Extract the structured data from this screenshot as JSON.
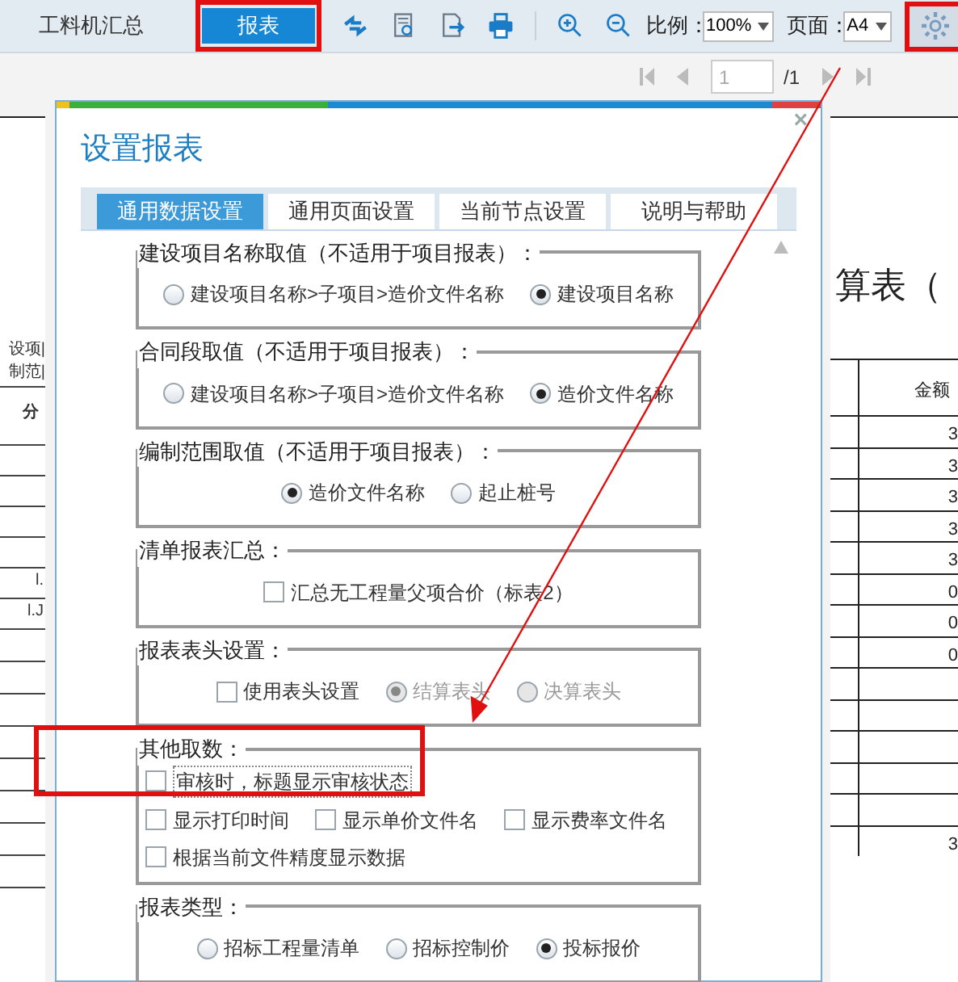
{
  "toolbar": {
    "tabs": [
      {
        "label": "工料机汇总",
        "selected": false
      },
      {
        "label": "报表",
        "selected": true
      }
    ],
    "scale_label": "比例：",
    "scale_value": "100%",
    "page_label": "页面：",
    "page_value": "A4"
  },
  "pager": {
    "page": "1",
    "total": "/1"
  },
  "left_page": {
    "lines": [
      "设项|",
      "制范|"
    ],
    "header": "分",
    "cells": [
      "l.",
      "l.J"
    ]
  },
  "right_page": {
    "title": "算表（",
    "header": "金额",
    "cells": [
      "3",
      "3",
      "3",
      "3",
      "3",
      "0",
      "0",
      "0",
      "",
      "",
      "",
      "",
      "",
      "3"
    ]
  },
  "dialog": {
    "title": "设置报表",
    "close": "×",
    "tabs": [
      {
        "label": "通用数据设置",
        "selected": true
      },
      {
        "label": "通用页面设置",
        "selected": false
      },
      {
        "label": "当前节点设置",
        "selected": false
      },
      {
        "label": "说明与帮助",
        "selected": false
      }
    ],
    "groups": [
      {
        "legend": "建设项目名称取值（不适用于项目报表）：",
        "kind": "options",
        "rows": [
          [
            {
              "kind": "radio",
              "label": "建设项目名称>子项目>造价文件名称",
              "selected": false,
              "disabled": false
            },
            {
              "kind": "radio",
              "label": "建设项目名称",
              "selected": true,
              "disabled": false
            }
          ]
        ]
      },
      {
        "legend": "合同段取值（不适用于项目报表）：",
        "kind": "options",
        "rows": [
          [
            {
              "kind": "radio",
              "label": "建设项目名称>子项目>造价文件名称",
              "selected": false,
              "disabled": false
            },
            {
              "kind": "radio",
              "label": "造价文件名称",
              "selected": true,
              "disabled": false
            }
          ]
        ]
      },
      {
        "legend": "编制范围取值（不适用于项目报表）：",
        "kind": "options",
        "rows": [
          [
            {
              "kind": "radio",
              "label": "造价文件名称",
              "selected": true,
              "disabled": false
            },
            {
              "kind": "radio",
              "label": "起止桩号",
              "selected": false,
              "disabled": false
            }
          ]
        ]
      },
      {
        "legend": "清单报表汇总：",
        "kind": "options",
        "rows": [
          [
            {
              "kind": "checkbox",
              "label": "汇总无工程量父项合价（标表2）",
              "checked": false
            }
          ]
        ]
      },
      {
        "legend": "报表表头设置：",
        "kind": "options",
        "rows": [
          [
            {
              "kind": "checkbox",
              "label": "使用表头设置",
              "checked": false
            },
            {
              "kind": "radio",
              "label": "结算表头",
              "selected": true,
              "disabled": true
            },
            {
              "kind": "radio",
              "label": "决算表头",
              "selected": false,
              "disabled": true
            }
          ]
        ]
      },
      {
        "legend": "其他取数：",
        "kind": "checklist",
        "highlighted": true,
        "rows": [
          [
            {
              "kind": "checkbox",
              "label": "审核时，标题显示审核状态",
              "checked": false
            }
          ],
          [
            {
              "kind": "checkbox",
              "label": "显示打印时间",
              "checked": false
            },
            {
              "kind": "checkbox",
              "label": "显示单价文件名",
              "checked": false
            },
            {
              "kind": "checkbox",
              "label": "显示费率文件名",
              "checked": false
            }
          ],
          [
            {
              "kind": "checkbox",
              "label": "根据当前文件精度显示数据",
              "checked": false
            }
          ]
        ]
      },
      {
        "legend": "报表类型：",
        "kind": "options",
        "rows": [
          [
            {
              "kind": "radio",
              "label": "招标工程量清单",
              "selected": false,
              "disabled": false
            },
            {
              "kind": "radio",
              "label": "招标控制价",
              "selected": false,
              "disabled": false
            },
            {
              "kind": "radio",
              "label": "投标报价",
              "selected": true,
              "disabled": false
            }
          ]
        ]
      }
    ]
  }
}
